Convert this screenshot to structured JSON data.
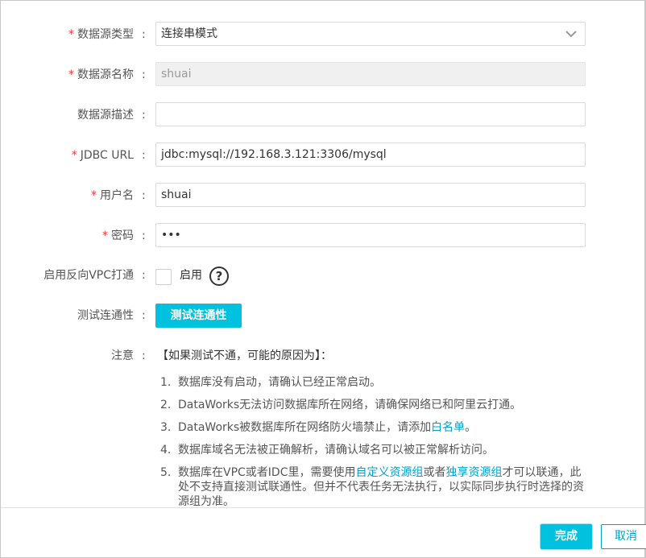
{
  "form": {
    "datasource_type": {
      "label": "数据源类型",
      "value": "连接串模式"
    },
    "datasource_name": {
      "label": "数据源名称",
      "value": "shuai"
    },
    "datasource_desc": {
      "label": "数据源描述",
      "value": ""
    },
    "jdbc_url": {
      "label": "JDBC URL",
      "value": "jdbc:mysql://192.168.3.121:3306/mysql"
    },
    "username": {
      "label": "用户名",
      "value": "shuai"
    },
    "password": {
      "label": "密码",
      "value": "•••"
    },
    "reverse_vpc": {
      "label": "启用反向VPC打通",
      "checkbox_label": "启用",
      "checked": false,
      "help_glyph": "?"
    },
    "test_connectivity": {
      "label": "测试连通性",
      "button_label": "测试连通性"
    },
    "required_mark": "*",
    "colon": ":"
  },
  "notes": {
    "label": "注意",
    "heading": "【如果测试不通，可能的原因为】：",
    "items": [
      {
        "num": "1.",
        "text": "数据库没有启动，请确认已经正常启动。"
      },
      {
        "num": "2.",
        "text": "DataWorks无法访问数据库所在网络，请确保网络已和阿里云打通。"
      },
      {
        "num": "3.",
        "text_before": "DataWorks被数据库所在网络防火墙禁止，请添加",
        "link": "白名单",
        "text_after": "。"
      },
      {
        "num": "4.",
        "text": "数据库域名无法被正确解析，请确认域名可以被正常解析访问。"
      },
      {
        "num": "5.",
        "text_before": "数据库在VPC或者IDC里，需要使用",
        "link1": "自定义资源组",
        "text_mid": "或者",
        "link2": "独享资源组",
        "text_after": "才可以联通，此处不支持直接测试联通性。但并不代表任务无法执行，以实际同步执行时选择的资源组为准。"
      }
    ]
  },
  "footer": {
    "ok_label": "完成",
    "cancel_label": "取消"
  },
  "colors": {
    "accent": "#00c1de",
    "link": "#00a2ca",
    "required": "#e5393b"
  },
  "icons": {
    "select_arrow": "chevron-down-icon",
    "help": "question-circle-icon"
  }
}
